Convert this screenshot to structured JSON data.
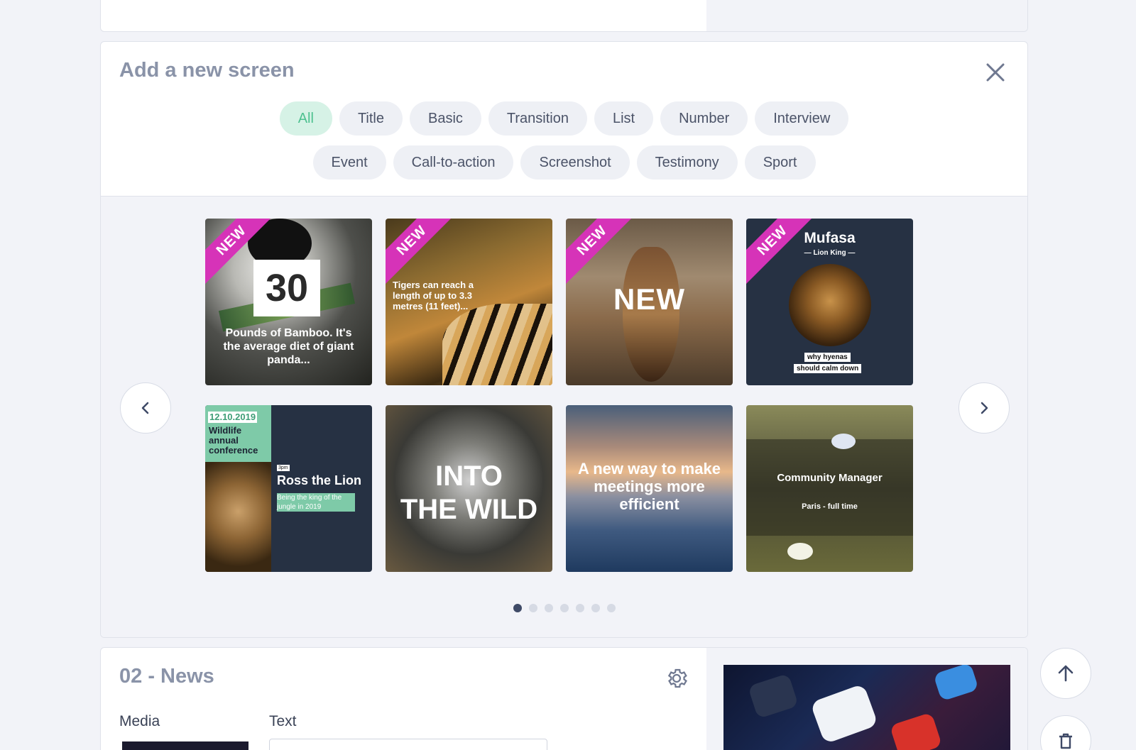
{
  "add_screen": {
    "title": "Add a new screen",
    "filters_row1": [
      "All",
      "Title",
      "Basic",
      "Transition",
      "List",
      "Number",
      "Interview"
    ],
    "filters_row2": [
      "Event",
      "Call-to-action",
      "Screenshot",
      "Testimony",
      "Sport"
    ],
    "active_filter": "All",
    "badge": "NEW",
    "templates": {
      "panda": {
        "number": "30",
        "caption": "Pounds of Bamboo. It's the average diet of giant panda..."
      },
      "tiger": {
        "caption": "Tigers can reach a length of up to 3.3 metres (11 feet)..."
      },
      "deer": {
        "caption": "NEW"
      },
      "mufasa": {
        "name": "Mufasa",
        "subtitle": "— Lion King —",
        "tag1": "why hyenas",
        "tag2": "should calm down"
      },
      "event": {
        "date": "12.10.2019",
        "event_title": "Wildlife annual conference",
        "time": "3pm",
        "speaker": "Ross the Lion",
        "speaker_desc": "Being the king of the jungle in 2019"
      },
      "raccoon": {
        "line1": "INTO",
        "line2": "THE WILD"
      },
      "sky": {
        "caption": "A new way to make meetings more efficient"
      },
      "community": {
        "role": "Community Manager",
        "detail": "Paris - full time"
      }
    },
    "page_count": 7,
    "current_page": 1
  },
  "news": {
    "title": "02 - News",
    "media_label": "Media",
    "text_label": "Text"
  },
  "colors": {
    "accent_green": "#4ec190",
    "badge_magenta": "#d633b8",
    "navy": "#263143"
  }
}
